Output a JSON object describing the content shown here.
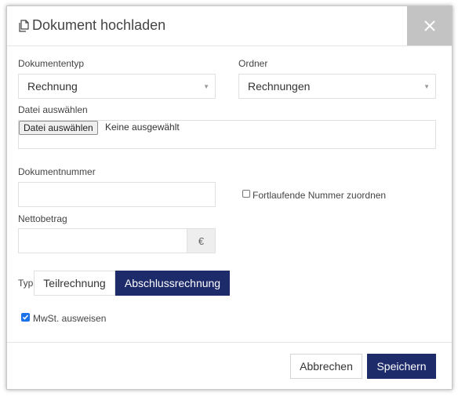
{
  "dialog": {
    "title": "Dokument hochladen",
    "close_label": "×"
  },
  "form": {
    "document_type": {
      "label": "Dokumententyp",
      "value": "Rechnung"
    },
    "folder": {
      "label": "Ordner",
      "value": "Rechnungen"
    },
    "file": {
      "label": "Datei auswählen",
      "button": "Datei auswählen",
      "status": "Keine ausgewählt"
    },
    "document_number": {
      "label": "Dokumentnummer",
      "value": ""
    },
    "sequential_number": {
      "label": "Fortlaufende Nummer zuordnen",
      "checked": false
    },
    "net_amount": {
      "label": "Nettobetrag",
      "value": "",
      "currency": "€"
    },
    "type": {
      "label": "Typ",
      "options": [
        "Teilrechnung",
        "Abschlussrechnung"
      ],
      "selected": "Abschlussrechnung"
    },
    "show_vat": {
      "label": "MwSt. ausweisen",
      "checked": true
    }
  },
  "footer": {
    "cancel_label": "Abbrechen",
    "save_label": "Speichern"
  },
  "colors": {
    "primary": "#1d2b6b",
    "close_bg": "#c3c3c3",
    "checkbox": "#1a73e8"
  }
}
